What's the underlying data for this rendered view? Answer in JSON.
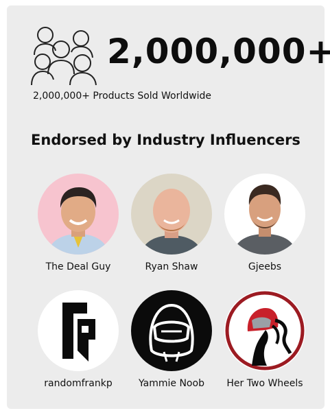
{
  "stats": {
    "headline_number": "2,000,000+",
    "caption": "2,000,000+ Products Sold Worldwide"
  },
  "endorsements": {
    "heading": "Endorsed by Industry Influencers",
    "influencers": [
      {
        "name": "The Deal Guy"
      },
      {
        "name": "Ryan Shaw"
      },
      {
        "name": "Gjeebs"
      },
      {
        "name": "randomfrankp"
      },
      {
        "name": "Yammie Noob"
      },
      {
        "name": "Her Two Wheels"
      }
    ]
  },
  "colors": {
    "card_background": "#ececec",
    "text": "#111111",
    "helmet_accent": "#c8202a"
  }
}
